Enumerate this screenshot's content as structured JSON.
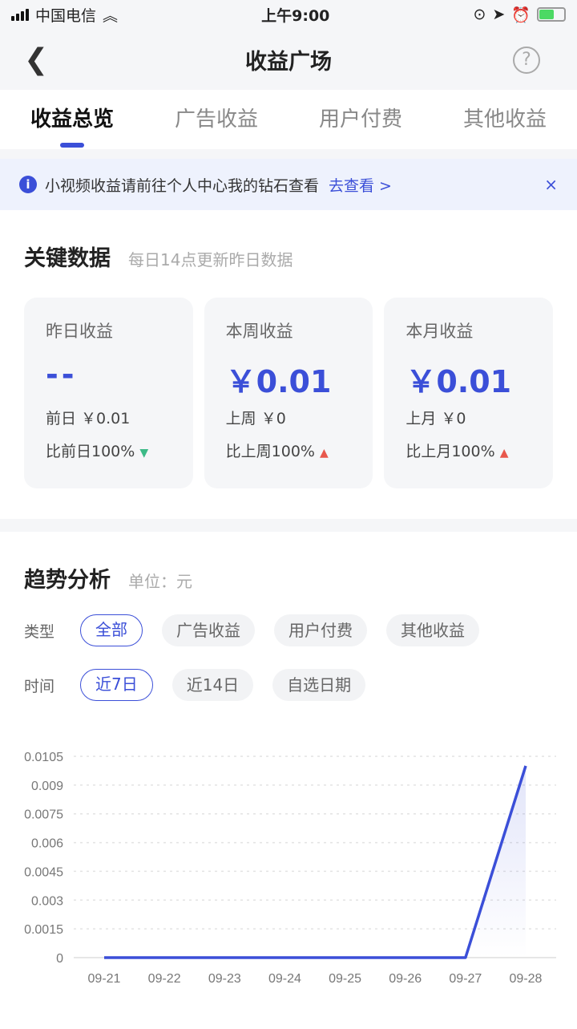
{
  "status": {
    "carrier": "中国电信",
    "time": "上午9:00",
    "battery_level": 0.6
  },
  "nav": {
    "back_icon": "chevron-left-icon",
    "title": "收益广场",
    "help_icon": "?"
  },
  "tabs": [
    {
      "label": "收益总览",
      "active": true
    },
    {
      "label": "广告收益"
    },
    {
      "label": "用户付费"
    },
    {
      "label": "其他收益"
    }
  ],
  "notice": {
    "icon": "i",
    "text": "小视频收益请前往个人中心我的钻石查看",
    "link": "去查看 >",
    "close": "×"
  },
  "key": {
    "title": "关键数据",
    "subtitle": "每日14点更新昨日数据",
    "cards": [
      {
        "label": "昨日收益",
        "value": "--",
        "prev": "前日 ￥0.01",
        "cmp": "比前日100%",
        "arrow": "▼",
        "dir": "down"
      },
      {
        "label": "本周收益",
        "value": "￥0.01",
        "prev": "上周 ￥0",
        "cmp": "比上周100%",
        "arrow": "▲",
        "dir": "up"
      },
      {
        "label": "本月收益",
        "value": "￥0.01",
        "prev": "上月 ￥0",
        "cmp": "比上月100%",
        "arrow": "▲",
        "dir": "up"
      }
    ]
  },
  "trend": {
    "title": "趋势分析",
    "unit": "单位：元",
    "type_label": "类型",
    "types": [
      "全部",
      "广告收益",
      "用户付费",
      "其他收益"
    ],
    "time_label": "时间",
    "times": [
      "近7日",
      "近14日",
      "自选日期"
    ]
  },
  "colors": {
    "accent": "#3b4fd8",
    "up": "#e8574c",
    "down": "#3cba87"
  },
  "chart_data": {
    "type": "area",
    "x": [
      "09-21",
      "09-22",
      "09-23",
      "09-24",
      "09-25",
      "09-26",
      "09-27",
      "09-28"
    ],
    "values": [
      0,
      0,
      0,
      0,
      0,
      0,
      0,
      0.01
    ],
    "yticks": [
      "0",
      "0.0015",
      "0.003",
      "0.0045",
      "0.006",
      "0.0075",
      "0.009",
      "0.0105"
    ],
    "ylim": [
      0,
      0.0105
    ],
    "grid": true,
    "color": "#3b4fd8"
  }
}
